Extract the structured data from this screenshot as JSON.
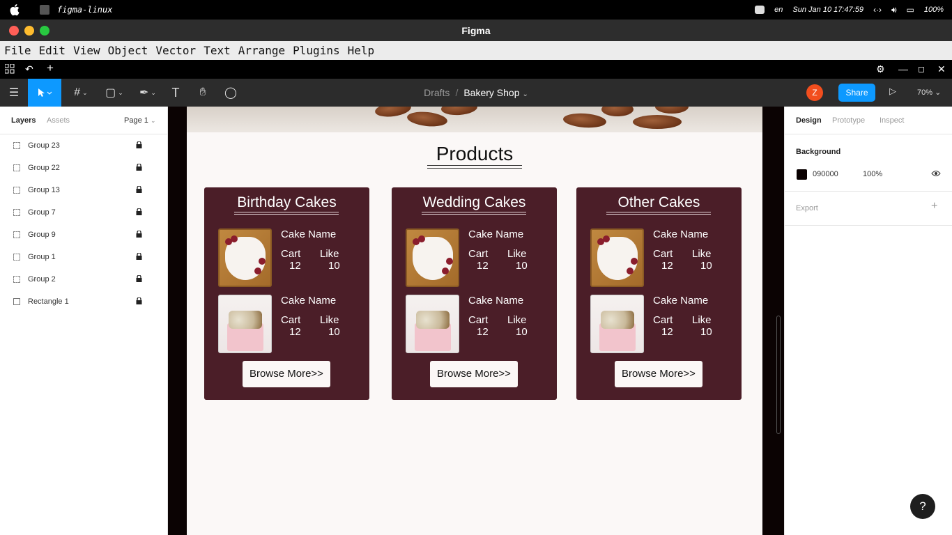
{
  "os": {
    "app_name": "figma-linux",
    "lang": "en",
    "datetime": "Sun Jan 10  17:47:59",
    "battery": "100%"
  },
  "window": {
    "title": "Figma"
  },
  "menu": [
    "File",
    "Edit",
    "View",
    "Object",
    "Vector",
    "Text",
    "Arrange",
    "Plugins",
    "Help"
  ],
  "toolbar": {
    "breadcrumb_root": "Drafts",
    "breadcrumb_sep": "/",
    "file_name": "Bakery Shop",
    "avatar_initial": "Z",
    "share_label": "Share",
    "zoom": "70%"
  },
  "left_panel": {
    "tab_layers": "Layers",
    "tab_assets": "Assets",
    "page": "Page 1",
    "layers": [
      {
        "name": "Group 23",
        "type": "frame"
      },
      {
        "name": "Group 22",
        "type": "frame"
      },
      {
        "name": "Group 13",
        "type": "frame"
      },
      {
        "name": "Group 7",
        "type": "frame"
      },
      {
        "name": "Group 9",
        "type": "frame"
      },
      {
        "name": "Group 1",
        "type": "frame"
      },
      {
        "name": "Group 2",
        "type": "frame"
      },
      {
        "name": "Rectangle 1",
        "type": "rect"
      }
    ]
  },
  "canvas": {
    "heading": "Products",
    "cards": [
      {
        "title": "Birthday Cakes",
        "items": [
          {
            "name": "Cake Name",
            "cart_label": "Cart",
            "like_label": "Like",
            "cart": "12",
            "like": "10"
          },
          {
            "name": "Cake Name",
            "cart_label": "Cart",
            "like_label": "Like",
            "cart": "12",
            "like": "10"
          }
        ],
        "button": "Browse More>>"
      },
      {
        "title": "Wedding Cakes",
        "items": [
          {
            "name": "Cake Name",
            "cart_label": "Cart",
            "like_label": "Like",
            "cart": "12",
            "like": "10"
          },
          {
            "name": "Cake Name",
            "cart_label": "Cart",
            "like_label": "Like",
            "cart": "12",
            "like": "10"
          }
        ],
        "button": "Browse More>>"
      },
      {
        "title": "Other Cakes",
        "items": [
          {
            "name": "Cake Name",
            "cart_label": "Cart",
            "like_label": "Like",
            "cart": "12",
            "like": "10"
          },
          {
            "name": "Cake Name",
            "cart_label": "Cart",
            "like_label": "Like",
            "cart": "12",
            "like": "10"
          }
        ],
        "button": "Browse More>>"
      }
    ],
    "card_color": "#4b1e28"
  },
  "right_panel": {
    "tab_design": "Design",
    "tab_prototype": "Prototype",
    "tab_inspect": "Inspect",
    "background_label": "Background",
    "bg_hex": "090000",
    "bg_opacity": "100%",
    "export_label": "Export"
  },
  "colors": {
    "accent": "#0d99ff",
    "avatar": "#f24e1e"
  }
}
